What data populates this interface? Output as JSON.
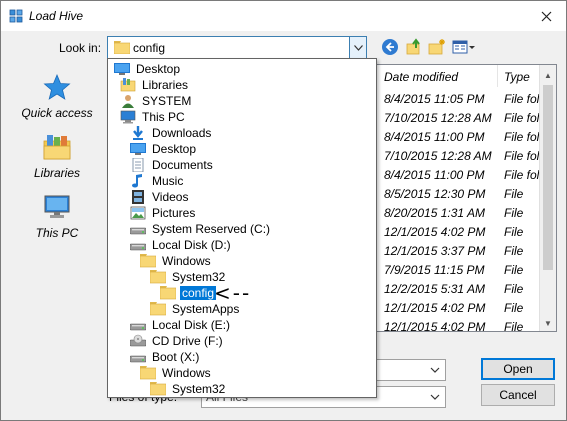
{
  "window": {
    "title": "Load Hive"
  },
  "lookin": {
    "label": "Look in:",
    "value": "config"
  },
  "places": [
    {
      "label": "Quick access",
      "icon": "star-icon"
    },
    {
      "label": "Libraries",
      "icon": "libraries-icon"
    },
    {
      "label": "This PC",
      "icon": "computer-icon"
    }
  ],
  "filelist": {
    "columns": [
      "Date modified",
      "Type"
    ],
    "rows": [
      {
        "date": "8/4/2015 11:05 PM",
        "type": "File fol"
      },
      {
        "date": "7/10/2015 12:28 AM",
        "type": "File fol"
      },
      {
        "date": "8/4/2015 11:00 PM",
        "type": "File fol"
      },
      {
        "date": "7/10/2015 12:28 AM",
        "type": "File fol"
      },
      {
        "date": "8/4/2015 11:00 PM",
        "type": "File fol"
      },
      {
        "date": "8/5/2015 12:30 PM",
        "type": "File"
      },
      {
        "date": "8/20/2015 1:31 AM",
        "type": "File"
      },
      {
        "date": "12/1/2015 4:02 PM",
        "type": "File"
      },
      {
        "date": "12/1/2015 3:37 PM",
        "type": "File"
      },
      {
        "date": "7/9/2015 11:15 PM",
        "type": "File"
      },
      {
        "date": "12/2/2015 5:31 AM",
        "type": "File"
      },
      {
        "date": "12/1/2015 4:02 PM",
        "type": "File"
      },
      {
        "date": "12/1/2015 4:02 PM",
        "type": "File"
      }
    ]
  },
  "filetype": {
    "label": "Files of type:",
    "value": "All Files"
  },
  "buttons": {
    "open": "Open",
    "cancel": "Cancel"
  },
  "dropdown": {
    "items": [
      {
        "label": "Desktop",
        "icon": "desktop-icon",
        "level": 0
      },
      {
        "label": "Libraries",
        "icon": "libraries-icon",
        "level": 1
      },
      {
        "label": "SYSTEM",
        "icon": "user-icon",
        "level": 1
      },
      {
        "label": "This PC",
        "icon": "computer-icon",
        "level": 1
      },
      {
        "label": "Downloads",
        "icon": "downloads-icon",
        "level": 2
      },
      {
        "label": "Desktop",
        "icon": "desktop-icon",
        "level": 2
      },
      {
        "label": "Documents",
        "icon": "documents-icon",
        "level": 2
      },
      {
        "label": "Music",
        "icon": "music-icon",
        "level": 2
      },
      {
        "label": "Videos",
        "icon": "videos-icon",
        "level": 2
      },
      {
        "label": "Pictures",
        "icon": "pictures-icon",
        "level": 2
      },
      {
        "label": "System Reserved (C:)",
        "icon": "drive-icon",
        "level": 2
      },
      {
        "label": "Local Disk (D:)",
        "icon": "drive-icon",
        "level": 2
      },
      {
        "label": "Windows",
        "icon": "folder-icon",
        "level": 3
      },
      {
        "label": "System32",
        "icon": "folder-icon",
        "level": 4
      },
      {
        "label": "config",
        "icon": "folder-icon",
        "level": 5,
        "selected": true
      },
      {
        "label": "SystemApps",
        "icon": "folder-icon",
        "level": 4
      },
      {
        "label": "Local Disk (E:)",
        "icon": "drive-icon",
        "level": 2
      },
      {
        "label": "CD Drive (F:)",
        "icon": "cd-drive-icon",
        "level": 2
      },
      {
        "label": "Boot (X:)",
        "icon": "drive-icon",
        "level": 2
      },
      {
        "label": "Windows",
        "icon": "folder-icon",
        "level": 3
      },
      {
        "label": "System32",
        "icon": "folder-icon",
        "level": 4
      }
    ]
  },
  "annotation": {
    "arrow": "<--"
  },
  "colors": {
    "selection": "#0078d7",
    "folder": "#f8d775",
    "accent": "#3c7fb1"
  }
}
